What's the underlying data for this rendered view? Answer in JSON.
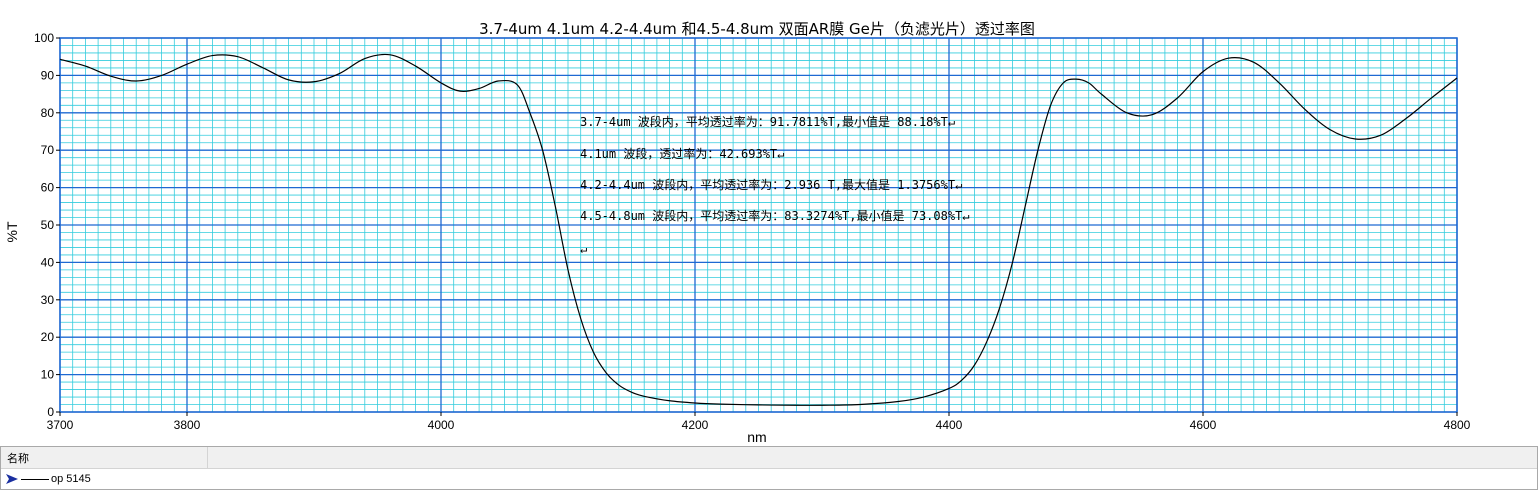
{
  "chart_data": {
    "type": "line",
    "title": "3.7-4um 4.1um 4.2-4.4um 和4.5-4.8um  双面AR膜 Ge片（负滤光片）透过率图",
    "xlabel": "nm",
    "ylabel": "%T",
    "xlim": [
      3700,
      4800
    ],
    "ylim": [
      0,
      100
    ],
    "x_ticks": [
      "3700",
      "3800",
      "4000",
      "4200",
      "4400",
      "4600",
      "4800"
    ],
    "y_ticks": [
      "0",
      "10",
      "20",
      "30",
      "40",
      "50",
      "60",
      "70",
      "80",
      "90",
      "100"
    ],
    "grid": true,
    "colors": {
      "series": "#000000",
      "major_grid": "#1e69d2",
      "minor_grid": "#33ccdd"
    },
    "series": [
      {
        "name": "op 5145",
        "x": [
          3700,
          3720,
          3740,
          3760,
          3780,
          3800,
          3820,
          3840,
          3860,
          3880,
          3900,
          3920,
          3940,
          3960,
          3980,
          4000,
          4015,
          4030,
          4045,
          4060,
          4070,
          4080,
          4090,
          4100,
          4110,
          4120,
          4130,
          4140,
          4150,
          4160,
          4180,
          4200,
          4220,
          4250,
          4280,
          4300,
          4330,
          4360,
          4380,
          4400,
          4410,
          4420,
          4430,
          4440,
          4450,
          4460,
          4470,
          4480,
          4490,
          4500,
          4510,
          4520,
          4540,
          4560,
          4580,
          4600,
          4620,
          4640,
          4660,
          4680,
          4700,
          4720,
          4740,
          4760,
          4780,
          4800
        ],
        "y": [
          94.3,
          92.5,
          89.8,
          88.5,
          90,
          93,
          95.3,
          95,
          92,
          88.8,
          88.3,
          90.5,
          94.5,
          95.5,
          92.5,
          88,
          85.8,
          86.5,
          88.5,
          87.5,
          80,
          70,
          55,
          38,
          25,
          16,
          10.5,
          7.2,
          5.3,
          4.2,
          3,
          2.4,
          2.1,
          1.9,
          1.8,
          1.8,
          2,
          2.8,
          4,
          6.3,
          8.5,
          12.5,
          19,
          28,
          40,
          55,
          70,
          82,
          88,
          89,
          88,
          85,
          80,
          79.5,
          84,
          91,
          94.6,
          93.5,
          88,
          81,
          75.5,
          73,
          74,
          78.5,
          84,
          89.3
        ]
      }
    ],
    "annotations": [
      "3.7-4um 波段内，平均透过率为：91.7811%T,最小值是 88.18%T↵",
      "4.1um 波段，透过率为：42.693%T↵",
      "4.2-4.4um 波段内，平均透过率为：2.936 T,最大值是 1.3756%T↵",
      "4.5-4.8um 波段内，平均透过率为：83.3274%T,最小值是 73.08%T↵",
      "↵"
    ]
  },
  "legend_panel": {
    "header_label": "名称",
    "series_label": "op 5145"
  }
}
